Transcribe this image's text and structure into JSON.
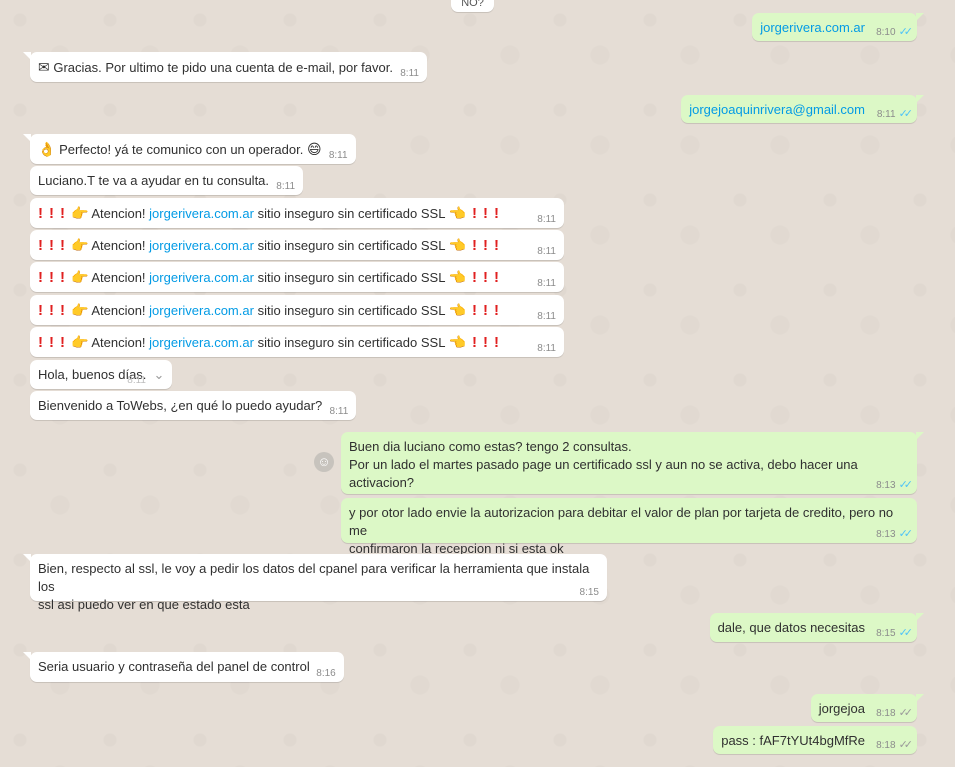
{
  "messages": {
    "m0": {
      "text": "NO?"
    },
    "m1": {
      "text": "jorgerivera.com.ar",
      "time": "8:10",
      "status": "read"
    },
    "m2": {
      "icon": "envelope-icon",
      "text": "Gracias. Por ultimo te pido una cuenta de e-mail, por favor.",
      "time": "8:11"
    },
    "m3": {
      "text": "jorgejoaquinrivera@gmail.com",
      "time": "8:11",
      "status": "read"
    },
    "m4": {
      "icon": "ok-hand-icon",
      "text": "Perfecto! yá te comunico con un operador.",
      "emoji_after": "grin-icon",
      "time": "8:11"
    },
    "m5": {
      "text": "Luciano.T te va a ayudar en tu consulta.",
      "time": "8:11"
    },
    "alert": {
      "prefix": "Atencion!",
      "link": "jorgerivera.com.ar",
      "suffix": "sitio inseguro sin certificado SSL",
      "time": "8:11",
      "count": 5
    },
    "m11": {
      "text": "Hola, buenos días.",
      "time": "8:11"
    },
    "m12": {
      "text": "Bienvenido a ToWebs, ¿en qué lo puedo ayudar?",
      "time": "8:11"
    },
    "m13": {
      "line1": "Buen dia luciano como estas? tengo 2 consultas.",
      "line2": "Por un lado el martes pasado page un certificado ssl y aun no se activa, debo hacer una activacion?",
      "time": "8:13",
      "status": "read"
    },
    "m14": {
      "line1": "y por otor lado envie la autorizacion para debitar el valor de plan por tarjeta de credito, pero no me",
      "line2": "confirmaron la recepcion ni si esta ok",
      "time": "8:13",
      "status": "read"
    },
    "m15": {
      "line1": "Bien, respecto al ssl, le voy a pedir los datos del cpanel para verificar la herramienta que instala los",
      "line2": "ssl asi puedo ver en que estado esta",
      "time": "8:15"
    },
    "m16": {
      "text": "dale, que datos necesitas",
      "time": "8:15",
      "status": "read"
    },
    "m17": {
      "text": "Seria usuario y contraseña del panel de control",
      "time": "8:16"
    },
    "m18": {
      "text": "jorgejoa",
      "time": "8:18",
      "status": "delivered"
    },
    "m19": {
      "text": "pass : fAF7tYUt4bgMfRe",
      "time": "8:18",
      "status": "delivered"
    }
  },
  "colors": {
    "incoming": "#ffffff",
    "outgoing": "#dcf8c6",
    "link": "#039be5",
    "read_check": "#4fc3f7",
    "background": "#e5ddd5"
  }
}
